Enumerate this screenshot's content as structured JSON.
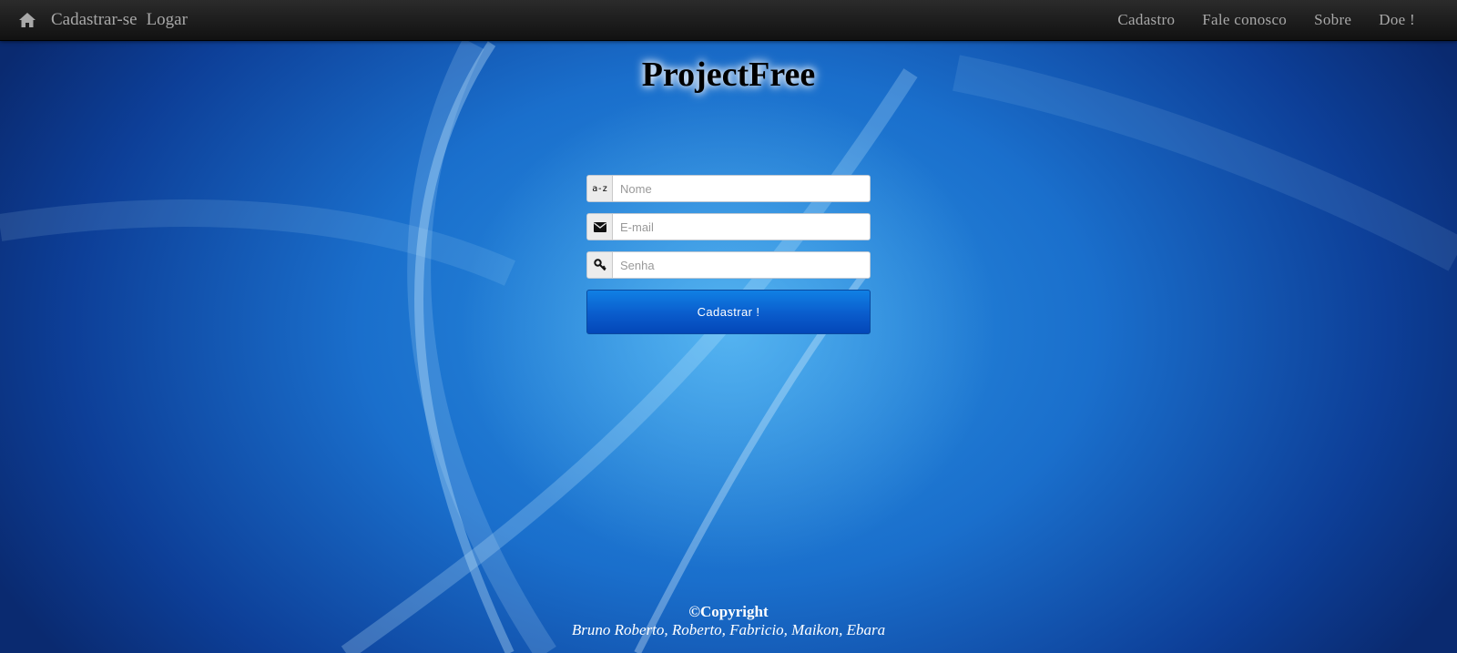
{
  "navbar": {
    "home_icon": "home-icon",
    "left_links": [
      "Cadastrar-se",
      "Logar"
    ],
    "right_links": [
      "Cadastro",
      "Fale conosco",
      "Sobre",
      "Doe !"
    ]
  },
  "page": {
    "title": "ProjectFree"
  },
  "form": {
    "name": {
      "icon_text": "a-z",
      "placeholder": "Nome",
      "value": ""
    },
    "email": {
      "icon": "envelope-icon",
      "placeholder": "E-mail",
      "value": ""
    },
    "password": {
      "icon": "key-icon",
      "placeholder": "Senha",
      "value": ""
    },
    "submit_label": "Cadastrar !"
  },
  "footer": {
    "copyright": "©Copyright",
    "authors": "Bruno Roberto, Roberto, Fabricio, Maikon, Ebara"
  },
  "colors": {
    "navbar": "#1a1a1a",
    "button": "#0a5ccc",
    "background": "#1a6fcc"
  }
}
